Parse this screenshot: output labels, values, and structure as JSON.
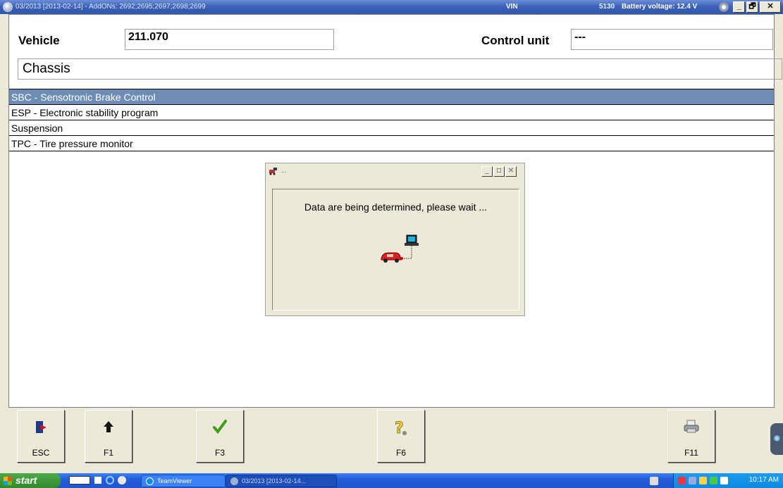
{
  "window": {
    "title": "03/2013 [2013-02-14] - AddONs: 2692;2695;2697;2698;2699",
    "vin_label": "VIN",
    "vin_tail": "5130",
    "battery": "Battery voltage: 12.4 V",
    "min_glyph": "_",
    "max_glyph": "🗗",
    "close_glyph": "✕"
  },
  "header": {
    "vehicle_label": "Vehicle",
    "vehicle_value": "211.070",
    "control_unit_label": "Control unit",
    "control_unit_value": "---"
  },
  "category": "Chassis",
  "list": [
    {
      "label": "SBC - Sensotronic Brake Control",
      "selected": true
    },
    {
      "label": "ESP - Electronic stability program",
      "selected": false
    },
    {
      "label": "Suspension",
      "selected": false
    },
    {
      "label": "TPC - Tire pressure monitor",
      "selected": false
    }
  ],
  "dialog": {
    "title": "...",
    "message": "Data are being determined, please wait ..."
  },
  "fkeys": [
    {
      "key": "ESC",
      "icon": "exit-door-icon"
    },
    {
      "key": "F1",
      "icon": "arrow-up-icon"
    },
    {
      "key": "F3",
      "icon": "checkmark-icon"
    },
    {
      "key": "F6",
      "icon": "help-question-icon"
    },
    {
      "key": "F11",
      "icon": "printer-icon"
    }
  ],
  "taskbar": {
    "start_label": "start",
    "tasks": [
      {
        "label": "TeamViewer"
      },
      {
        "label": "03/2013 [2013-02-14..."
      }
    ],
    "clock": "10:17 AM"
  },
  "colors": {
    "selection": "#6e8db4",
    "titlebar": "#3d62b8",
    "background": "#ece9d8"
  }
}
